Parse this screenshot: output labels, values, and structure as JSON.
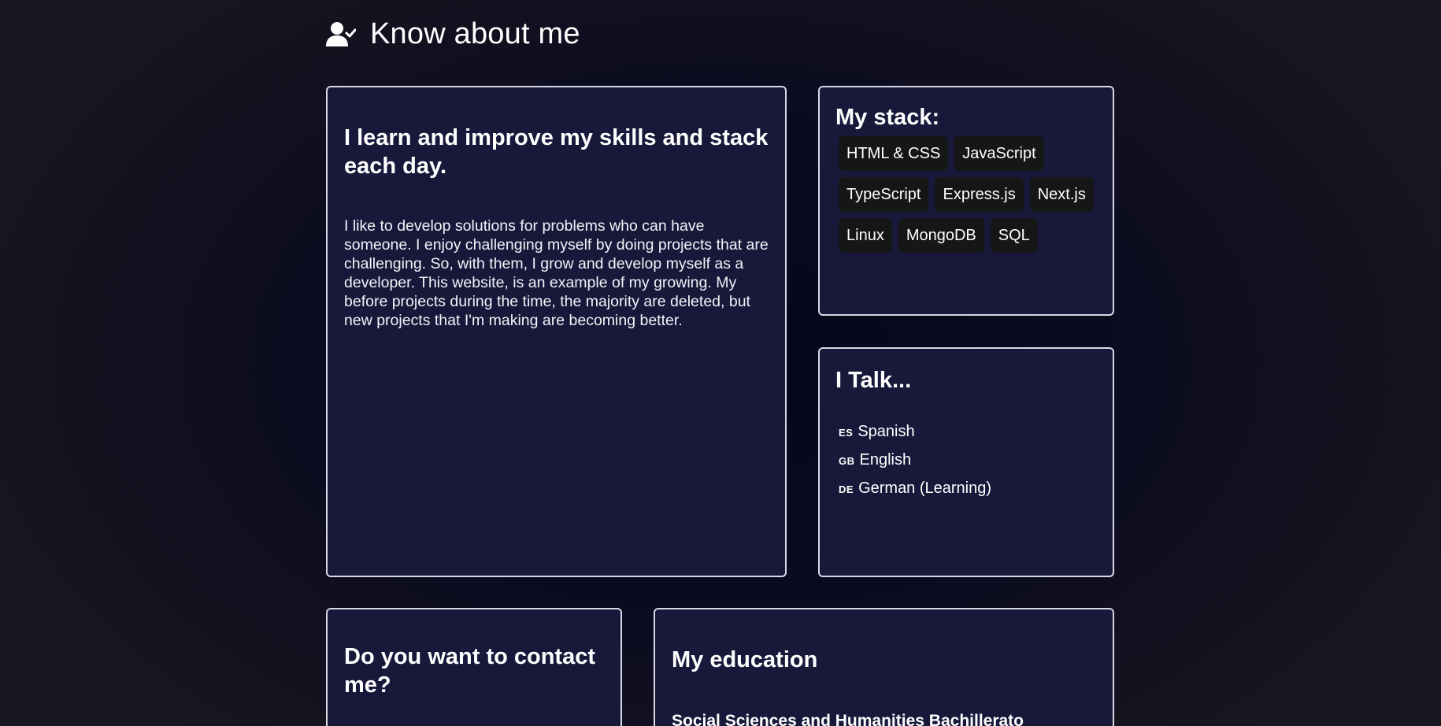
{
  "header": {
    "title": "Know about me",
    "icon": "user-check-icon"
  },
  "about": {
    "heading": "I learn and improve my skills and stack each day.",
    "body": "I like to develop solutions for problems who can have someone. I enjoy challenging myself by doing projects that are challenging. So, with them, I grow and develop myself as a developer. This website, is an example of my growing. My before projects during the time, the majority are deleted, but new projects that I'm making are becoming better."
  },
  "stack": {
    "heading": "My stack:",
    "items": [
      "HTML & CSS",
      "JavaScript",
      "TypeScript",
      "Express.js",
      "Next.js",
      "Linux",
      "MongoDB",
      "SQL"
    ]
  },
  "languages": {
    "heading": "I Talk...",
    "items": [
      {
        "code": "ES",
        "name": "Spanish"
      },
      {
        "code": "GB",
        "name": "English"
      },
      {
        "code": "DE",
        "name": "German (Learning)"
      }
    ]
  },
  "contact": {
    "heading": "Do you want to contact me?"
  },
  "education": {
    "heading": "My education",
    "items": [
      "Social Sciences and Humanities Bachillerato"
    ]
  },
  "colors": {
    "card_background": "#18193a",
    "card_border": "#d8d8e6",
    "chip_background": "#161616",
    "text": "#ffffff"
  }
}
